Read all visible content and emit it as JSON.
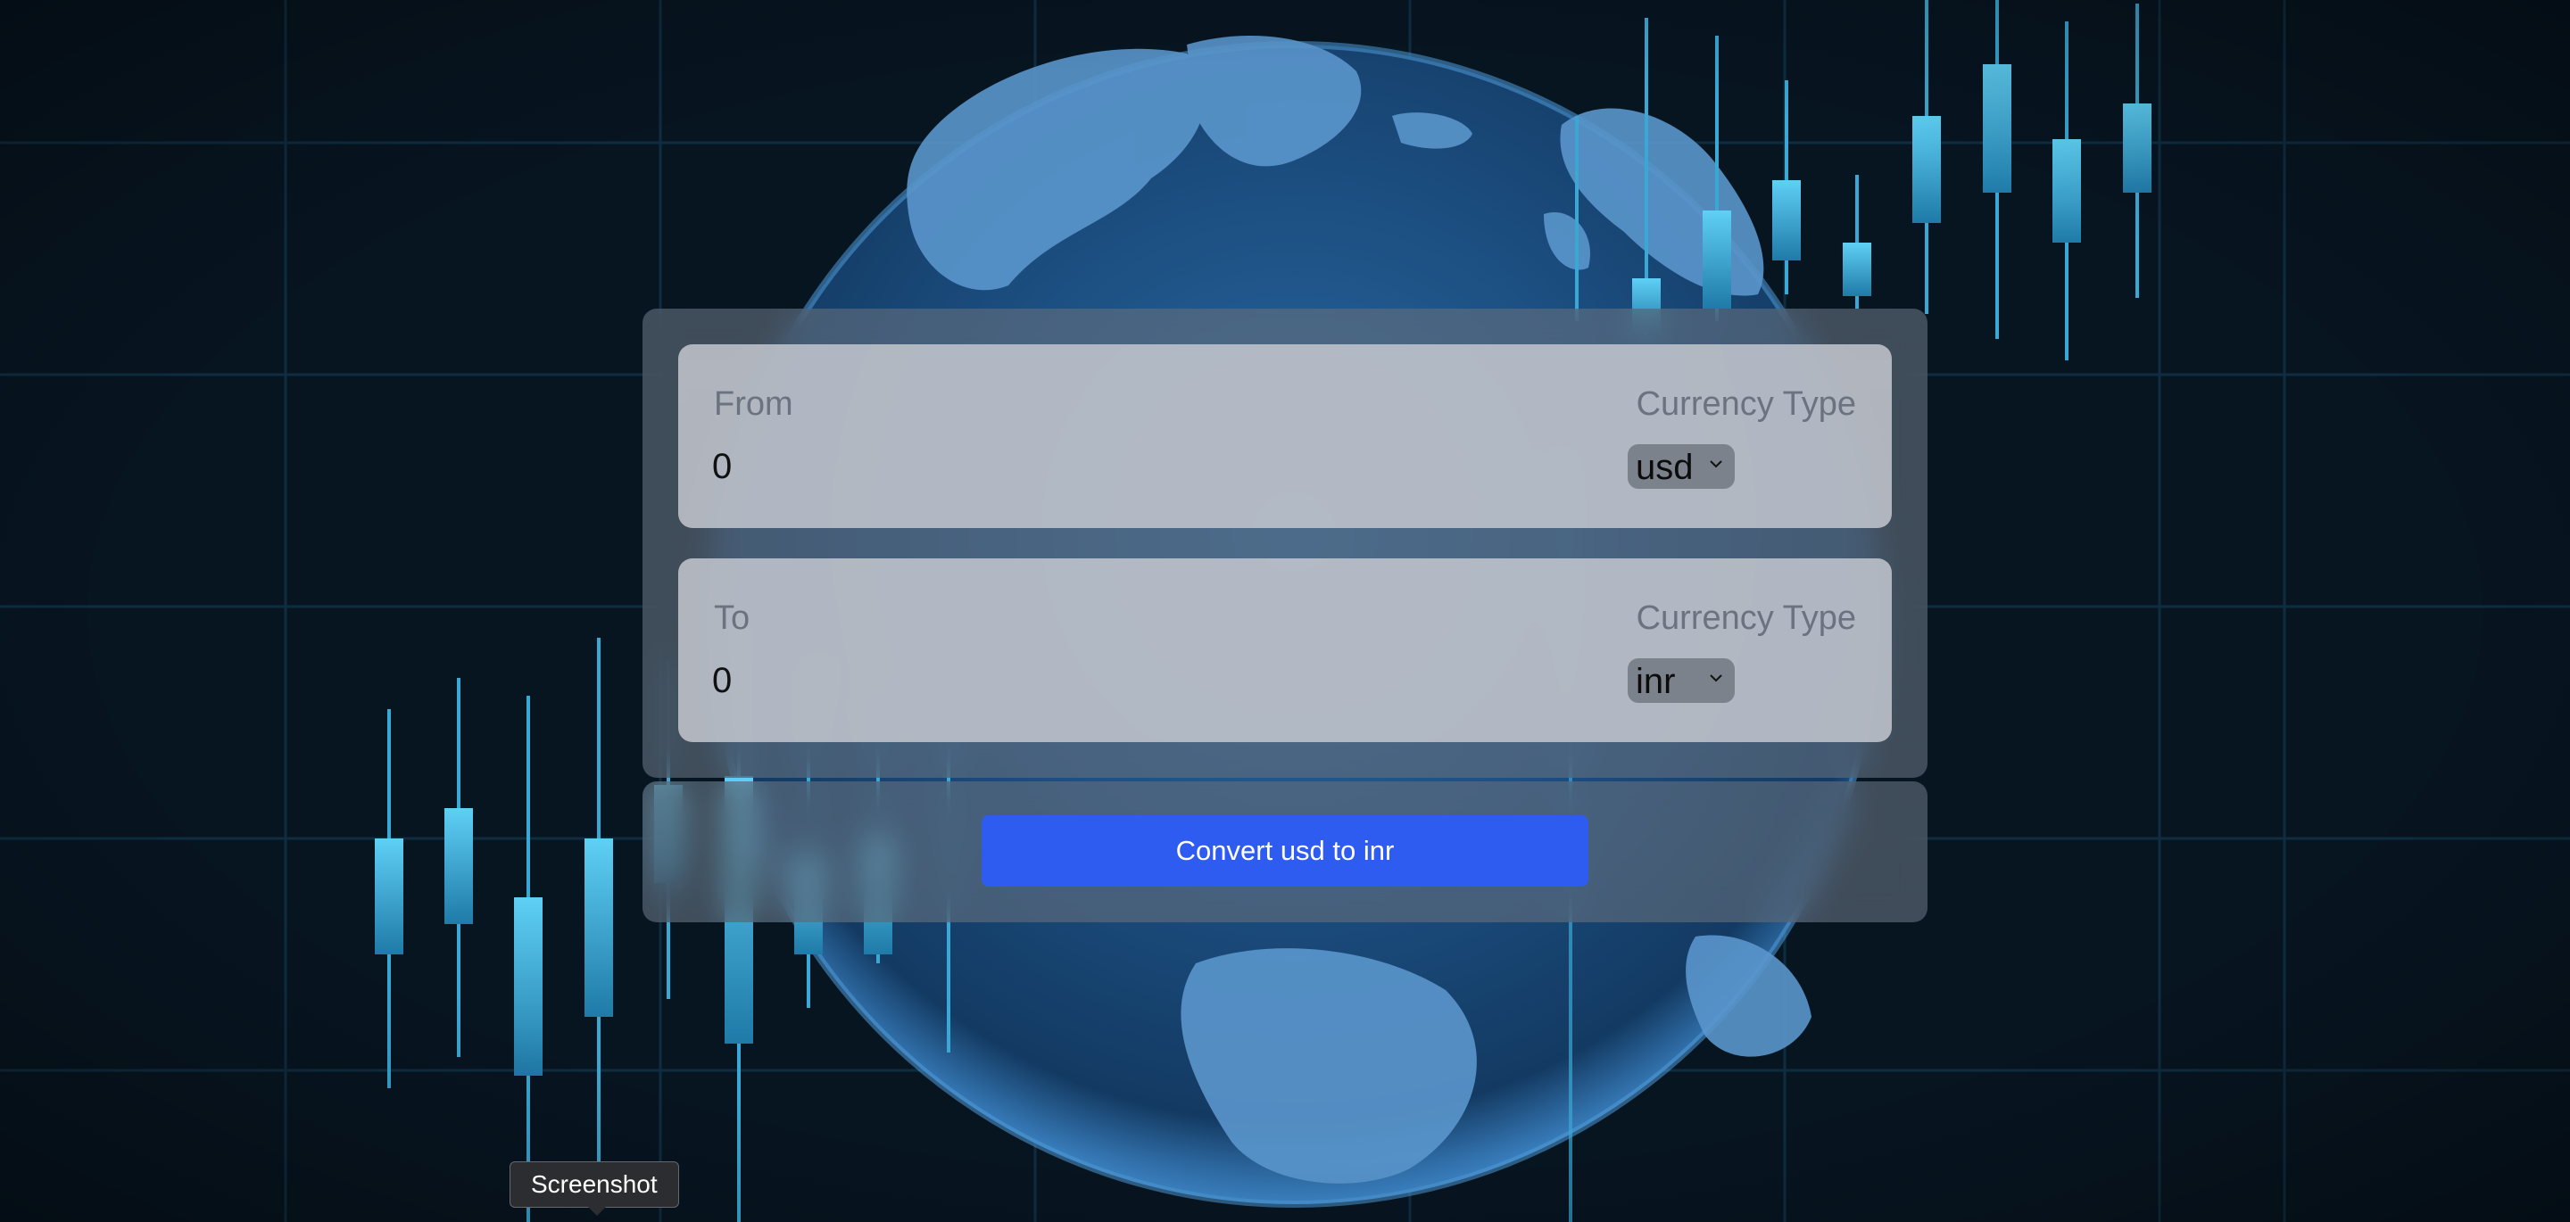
{
  "background": {
    "description_icon": "globe-stock-chart-background",
    "colors": {
      "base": "#071521",
      "globe": "#1f4f7f",
      "continents": "#5a96cc",
      "candles": "#4cc4ee",
      "grid": "#13364a"
    }
  },
  "converter": {
    "from": {
      "label": "From",
      "value": "0",
      "currency_type_label": "Currency Type",
      "currency": "usd"
    },
    "to": {
      "label": "To",
      "value": "0",
      "currency_type_label": "Currency Type",
      "currency": "inr"
    },
    "convert_button_label": "Convert usd to inr",
    "accent_color": "#2f5cf0"
  },
  "tooltip": {
    "text": "Screenshot"
  }
}
